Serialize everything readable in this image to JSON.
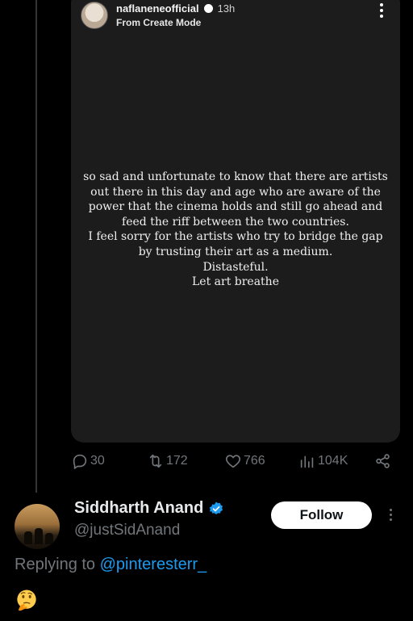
{
  "story": {
    "username": "naflaneneofficial",
    "time": "13h",
    "source": "From Create Mode",
    "lines": [
      "so sad and unfortunate to know that there are artists",
      "out there in this day and age who are aware of the",
      "power that the cinema holds and still go ahead and",
      "feed the riff between the two countries.",
      "I feel sorry for the artists who try to bridge the gap",
      "by trusting their art as a medium.",
      "Distasteful.",
      "Let art breathe"
    ]
  },
  "actions": {
    "replies": "30",
    "reposts": "172",
    "likes": "766",
    "views": "104K"
  },
  "reply_tweet": {
    "display_name": "Siddharth Anand",
    "handle": "@justSidAnand",
    "follow_label": "Follow",
    "replying_prefix": "Replying to",
    "replying_to": "@pinteresterr_",
    "body_emoji": "🤔"
  },
  "colors": {
    "accent": "#1d9bf0",
    "muted": "#71767b",
    "background": "#000000"
  }
}
